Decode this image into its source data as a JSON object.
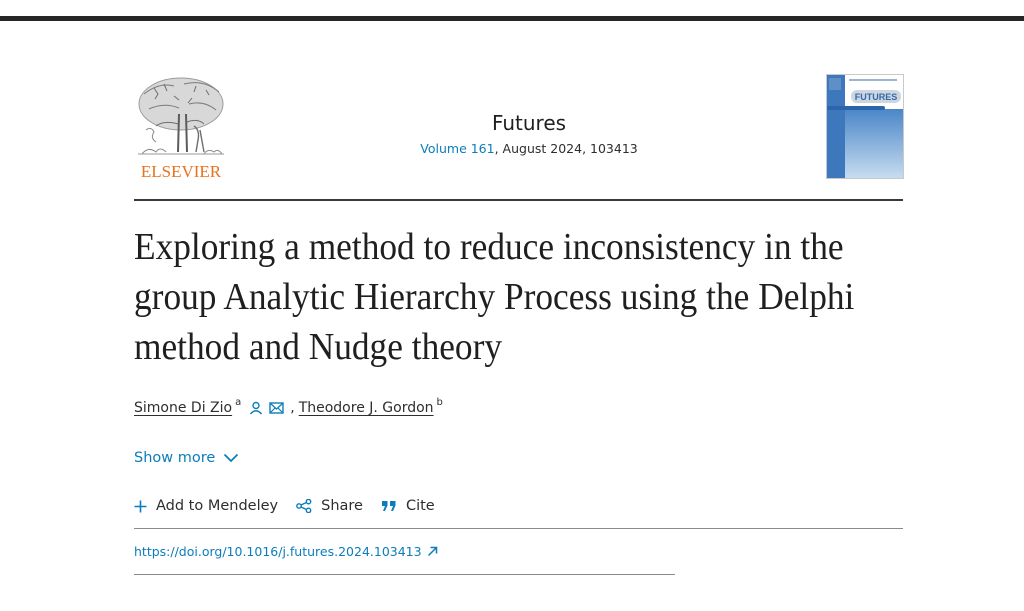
{
  "publisher": {
    "name": "ELSEVIER",
    "logo_icon": "elsevier-tree-logo",
    "brand_color": "#e9711c"
  },
  "journal": {
    "title": "Futures",
    "volume_link": "Volume 161",
    "issue_details": ", August 2024, 103413",
    "cover_title": "FUTURES",
    "link_color": "#0c7dbb"
  },
  "article": {
    "title": "Exploring a method to reduce inconsistency in the group Analytic Hierarchy Process using the Delphi method and Nudge theory"
  },
  "authors": [
    {
      "name": "Simone Di Zio",
      "affiliation": "a",
      "icons": [
        "person-icon",
        "envelope-icon"
      ]
    },
    {
      "name": "Theodore J. Gordon",
      "affiliation": "b"
    }
  ],
  "author_separator": ",",
  "show_more": {
    "label": "Show more",
    "icon": "chevron-down-icon"
  },
  "actions": [
    {
      "label": "Add to Mendeley",
      "icon": "plus-icon"
    },
    {
      "label": "Share",
      "icon": "share-icon"
    },
    {
      "label": "Cite",
      "icon": "quote-icon"
    }
  ],
  "doi": {
    "url": "https://doi.org/10.1016/j.futures.2024.103413",
    "icon": "external-link-icon"
  }
}
